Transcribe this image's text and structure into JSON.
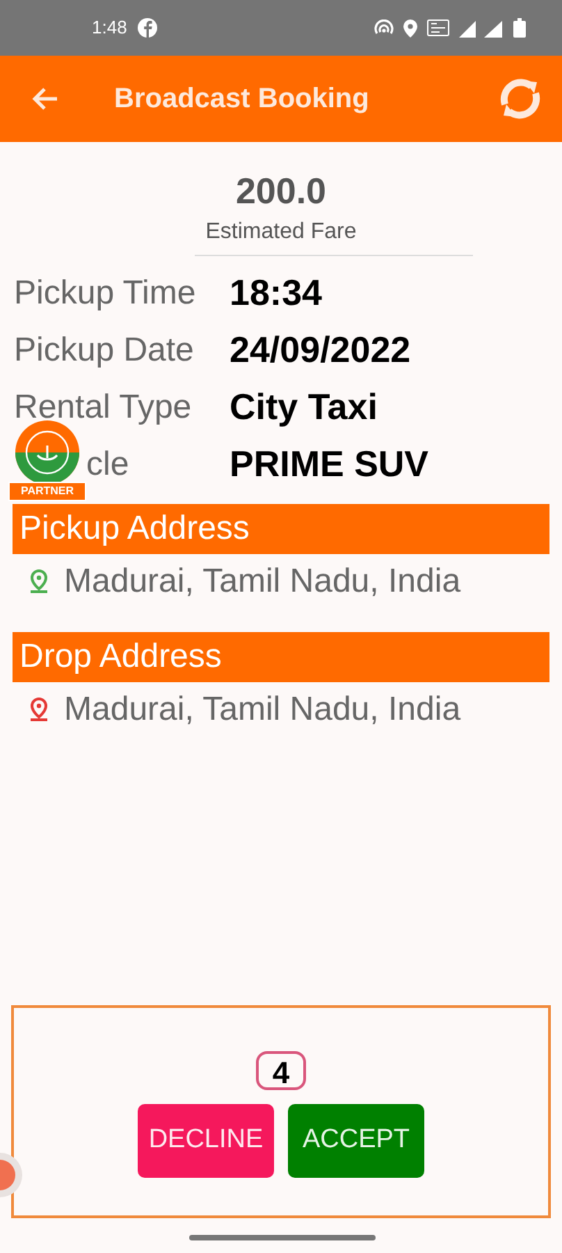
{
  "status_bar": {
    "time": "1:48"
  },
  "header": {
    "title": "Broadcast Booking"
  },
  "fare": {
    "amount": "200.0",
    "label": "Estimated Fare"
  },
  "details": [
    {
      "label": "Pickup Time",
      "value": "18:34"
    },
    {
      "label": "Pickup Date",
      "value": "24/09/2022"
    },
    {
      "label": "Rental Type",
      "value": "City Taxi"
    },
    {
      "label": "cle",
      "value": "PRIME SUV"
    }
  ],
  "partner_badge": {
    "label": "PARTNER"
  },
  "sections": [
    {
      "kind": "pickup",
      "title": "Pickup Address",
      "address": "Madurai, Tamil Nadu, India"
    },
    {
      "kind": "drop",
      "title": "Drop Address",
      "address": "Madurai, Tamil Nadu, India"
    }
  ],
  "countdown": "4",
  "buttons": [
    {
      "kind": "decline",
      "label": "DECLINE"
    },
    {
      "kind": "accept",
      "label": "ACCEPT"
    }
  ]
}
